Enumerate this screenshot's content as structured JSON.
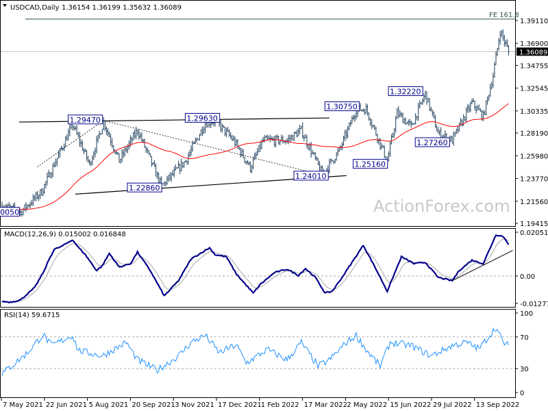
{
  "chart_data": [
    {
      "type": "ohlc",
      "title": "USDCAD,Daily",
      "ohlc_last": [
        "1.36154",
        "1.36199",
        "1.35632",
        "1.36089"
      ],
      "current_price_label": "1.36089",
      "ylim": [
        1.19415,
        1.3911
      ],
      "y_ticks": [
        "1.39110",
        "1.36900",
        "1.34755",
        "1.32545",
        "1.30335",
        "1.28190",
        "1.25980",
        "1.23770",
        "1.21560",
        "1.19415"
      ],
      "y_tick_values": [
        1.3911,
        1.369,
        1.34755,
        1.32545,
        1.30335,
        1.2819,
        1.2598,
        1.2377,
        1.2156,
        1.19415
      ],
      "bars": 360,
      "close_keypoints": [
        [
          0,
          1.2116
        ],
        [
          13,
          1.2049
        ],
        [
          28,
          1.2249
        ],
        [
          50,
          1.29
        ],
        [
          62,
          1.2515
        ],
        [
          72,
          1.2927
        ],
        [
          83,
          1.2548
        ],
        [
          96,
          1.2847
        ],
        [
          113,
          1.2302
        ],
        [
          130,
          1.2548
        ],
        [
          144,
          1.2914
        ],
        [
          151,
          1.294
        ],
        [
          164,
          1.2747
        ],
        [
          176,
          1.2481
        ],
        [
          185,
          1.2747
        ],
        [
          202,
          1.2747
        ],
        [
          212,
          1.2847
        ],
        [
          227,
          1.2415
        ],
        [
          239,
          1.2648
        ],
        [
          251,
          1.3047
        ],
        [
          258,
          1.305
        ],
        [
          273,
          1.2548
        ],
        [
          280,
          1.3013
        ],
        [
          290,
          1.288
        ],
        [
          300,
          1.32
        ],
        [
          309,
          1.2814
        ],
        [
          319,
          1.2747
        ],
        [
          333,
          1.3113
        ],
        [
          341,
          1.298
        ],
        [
          348,
          1.3379
        ],
        [
          353,
          1.3811
        ],
        [
          359,
          1.36089
        ]
      ],
      "moving_average_period": 55,
      "moving_average_color": "#ff0000",
      "bar_color": "#1c3d5a",
      "annotations": [
        {
          "text": "1.29470",
          "bar": 59,
          "price": 1.2947
        },
        {
          "text": "1.29630",
          "bar": 142,
          "price": 1.2963
        },
        {
          "text": "1.22860",
          "bar": 101,
          "price": 1.2286
        },
        {
          "text": "1.24010",
          "bar": 219,
          "price": 1.2401
        },
        {
          "text": "1.30750",
          "bar": 241,
          "price": 1.3075
        },
        {
          "text": "1.25160",
          "bar": 261,
          "price": 1.2516
        },
        {
          "text": "1.32220",
          "bar": 286,
          "price": 1.3222
        },
        {
          "text": "1.27260",
          "bar": 305,
          "price": 1.2726
        },
        {
          "text": "0050",
          "bar": 5,
          "price": 1.205
        }
      ],
      "fe_label": "FE 161.8",
      "fe_price": 1.3925,
      "trendlines": [
        {
          "name": "upper-channel",
          "from": [
            12,
            1.2925
          ],
          "to": [
            232,
            1.2965
          ],
          "style": "solid"
        },
        {
          "name": "lower-channel",
          "from": [
            52,
            1.2225
          ],
          "to": [
            244,
            1.2405
          ],
          "style": "solid"
        },
        {
          "name": "dotted-a",
          "from": [
            25,
            1.249
          ],
          "to": [
            72,
            1.294
          ],
          "style": "dotted"
        },
        {
          "name": "dotted-b",
          "from": [
            72,
            1.294
          ],
          "to": [
            227,
            1.241
          ],
          "style": "dotted"
        }
      ],
      "watermark": "ActionForex.com"
    },
    {
      "type": "line",
      "title": "MACD(12,26,9) 0.015002 0.016848",
      "ylim": [
        -0.012771,
        0.020518
      ],
      "y_ticks": [
        "0.020518",
        "0.00",
        "-0.012771"
      ],
      "y_tick_values": [
        0.020518,
        0.0,
        -0.012771
      ],
      "macd_color": "#00008b",
      "signal_color": "#a9a9a9",
      "macd_keypoints": [
        [
          0,
          -0.0119
        ],
        [
          6,
          -0.0122
        ],
        [
          13,
          -0.0112
        ],
        [
          23,
          -0.0055
        ],
        [
          30,
          0.0026
        ],
        [
          33,
          0.0074
        ],
        [
          37,
          0.0125
        ],
        [
          42,
          0.0138
        ],
        [
          50,
          0.017
        ],
        [
          54,
          0.0135
        ],
        [
          59,
          0.01
        ],
        [
          67,
          0.0026
        ],
        [
          71,
          0.0048
        ],
        [
          76,
          0.0106
        ],
        [
          83,
          0.0042
        ],
        [
          91,
          0.0058
        ],
        [
          96,
          0.0112
        ],
        [
          105,
          0.0026
        ],
        [
          115,
          -0.0093
        ],
        [
          125,
          -0.0022
        ],
        [
          134,
          0.008
        ],
        [
          147,
          0.0132
        ],
        [
          151,
          0.01
        ],
        [
          159,
          0.009
        ],
        [
          166,
          0.001
        ],
        [
          178,
          -0.008
        ],
        [
          183,
          -0.0039
        ],
        [
          193,
          0.0016
        ],
        [
          202,
          0.0032
        ],
        [
          210,
          0.0003
        ],
        [
          215,
          0.0035
        ],
        [
          222,
          -0.0006
        ],
        [
          229,
          -0.008
        ],
        [
          234,
          -0.0071
        ],
        [
          241,
          -0.0006
        ],
        [
          249,
          0.0074
        ],
        [
          256,
          0.0144
        ],
        [
          263,
          0.0058
        ],
        [
          273,
          -0.0071
        ],
        [
          283,
          0.009
        ],
        [
          292,
          0.0058
        ],
        [
          300,
          0.0064
        ],
        [
          309,
          -0.0006
        ],
        [
          319,
          -0.0022
        ],
        [
          324,
          0.0026
        ],
        [
          333,
          0.0074
        ],
        [
          341,
          0.0058
        ],
        [
          350,
          0.0193
        ],
        [
          355,
          0.0186
        ],
        [
          359,
          0.015
        ]
      ],
      "trendline": {
        "from": [
          319,
          -0.0022
        ],
        "to": [
          359,
          0.012
        ]
      }
    },
    {
      "type": "line",
      "title": "RSI(14) 59.6715",
      "ylim": [
        0,
        100
      ],
      "y_ticks": [
        "100",
        "70",
        "30",
        "0"
      ],
      "y_tick_values": [
        100,
        70,
        30,
        0
      ],
      "levels": [
        70,
        30
      ],
      "line_color": "#1e90ff",
      "rsi_keypoints": [
        [
          0,
          24
        ],
        [
          8,
          35
        ],
        [
          18,
          50
        ],
        [
          29,
          73
        ],
        [
          35,
          59
        ],
        [
          50,
          72
        ],
        [
          54,
          53
        ],
        [
          71,
          46
        ],
        [
          88,
          63
        ],
        [
          96,
          41
        ],
        [
          110,
          28
        ],
        [
          125,
          46
        ],
        [
          134,
          63
        ],
        [
          144,
          72
        ],
        [
          154,
          50
        ],
        [
          166,
          60
        ],
        [
          173,
          37
        ],
        [
          188,
          54
        ],
        [
          202,
          41
        ],
        [
          212,
          63
        ],
        [
          224,
          33
        ],
        [
          232,
          41
        ],
        [
          244,
          63
        ],
        [
          251,
          72
        ],
        [
          258,
          54
        ],
        [
          268,
          33
        ],
        [
          275,
          63
        ],
        [
          290,
          59
        ],
        [
          304,
          46
        ],
        [
          319,
          59
        ],
        [
          329,
          63
        ],
        [
          338,
          55
        ],
        [
          350,
          82
        ],
        [
          355,
          63
        ],
        [
          359,
          59.67
        ]
      ]
    }
  ],
  "x_axis": {
    "labels": [
      "7 May 2021",
      "22 Jun 2021",
      "5 Aug 2021",
      "20 Sep 2021",
      "3 Nov 2021",
      "17 Dec 2021",
      "1 Feb 2022",
      "17 Mar 2022",
      "2 May 2022",
      "15 Jun 2022",
      "29 Jul 2022",
      "13 Sep 2022"
    ]
  }
}
